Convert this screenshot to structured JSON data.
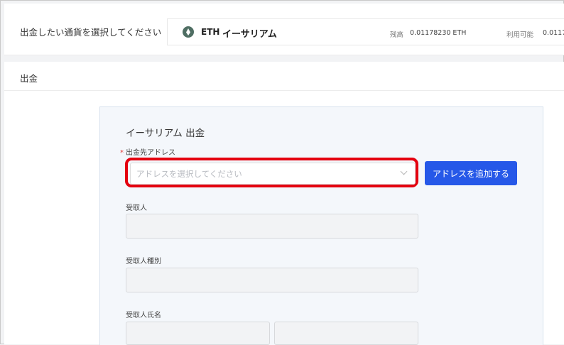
{
  "currency_selector": {
    "label": "出金したい通貨を選択してください",
    "selected": {
      "icon": "ethereum-icon",
      "code": "ETH",
      "name": "イーサリアム"
    },
    "balance_label": "残高",
    "balance_value": "0.01178230 ETH",
    "available_label": "利用可能",
    "available_value": "0.0117"
  },
  "section": {
    "title": "出金"
  },
  "form": {
    "title": "イーサリアム 出金",
    "address": {
      "required_mark": "*",
      "label": "出金先アドレス",
      "placeholder": "アドレスを選択してください",
      "add_button_label": "アドレスを追加する"
    },
    "recipient_label": "受取人",
    "recipient_type_label": "受取人種別",
    "recipient_name_label": "受取人氏名"
  },
  "colors": {
    "primary_button": "#2658e8",
    "highlight_border": "#e4000f",
    "required_mark": "#e53935"
  }
}
